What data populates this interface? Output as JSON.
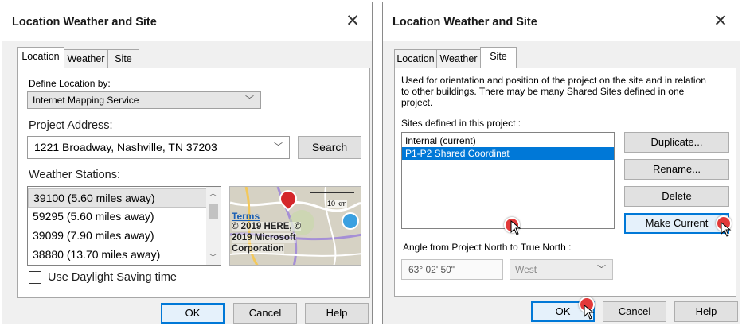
{
  "left_dialog": {
    "title": "Location Weather and Site",
    "close_glyph": "✕",
    "tabs": [
      {
        "label": "Location",
        "active": true
      },
      {
        "label": "Weather",
        "active": false
      },
      {
        "label": "Site",
        "active": false
      }
    ],
    "define_location_label": "Define Location by:",
    "define_location_value": "Internet Mapping Service",
    "project_address_label": "Project Address:",
    "project_address_value": "1221 Broadway, Nashville, TN 37203",
    "search_label": "Search",
    "weather_stations_label": "Weather Stations:",
    "stations": [
      "39100 (5.60 miles away)",
      "59295 (5.60 miles away)",
      "39099 (7.90 miles away)",
      "38880 (13.70 miles away)"
    ],
    "map": {
      "scale_label": "10 km",
      "terms_link": "Terms",
      "copyright_lines": [
        "© 2019 HERE, ©",
        "2019 Microsoft",
        "Corporation"
      ]
    },
    "daylight_saving_label": "Use Daylight Saving time",
    "daylight_saving_checked": false,
    "ok_label": "OK",
    "cancel_label": "Cancel",
    "help_label": "Help"
  },
  "right_dialog": {
    "title": "Location Weather and Site",
    "close_glyph": "✕",
    "tabs": [
      {
        "label": "Location",
        "active": false
      },
      {
        "label": "Weather",
        "active": false
      },
      {
        "label": "Site",
        "active": true
      }
    ],
    "description_lines": [
      "Used for orientation and position of the project on the site and in relation",
      "to other buildings. There may be many Shared Sites defined in one",
      "project."
    ],
    "sites_label": "Sites defined in this project :",
    "sites": [
      {
        "name": "Internal (current)",
        "selected": false
      },
      {
        "name": "P1-P2 Shared Coordinat",
        "selected": true
      }
    ],
    "duplicate_label": "Duplicate...",
    "rename_label": "Rename...",
    "delete_label": "Delete",
    "make_current_label": "Make Current",
    "angle_label": "Angle from Project North to True North :",
    "angle_value": "63° 02' 50\"",
    "direction_value": "West",
    "ok_label": "OK",
    "cancel_label": "Cancel",
    "help_label": "Help"
  },
  "colors": {
    "accent": "#0078d7",
    "selection": "#0078d7",
    "dialog_bg": "#f0f0f0",
    "cursor_marker": "#e23a3a",
    "map_marker": "#d4262a",
    "weather_pin": "#3aa0e0"
  }
}
